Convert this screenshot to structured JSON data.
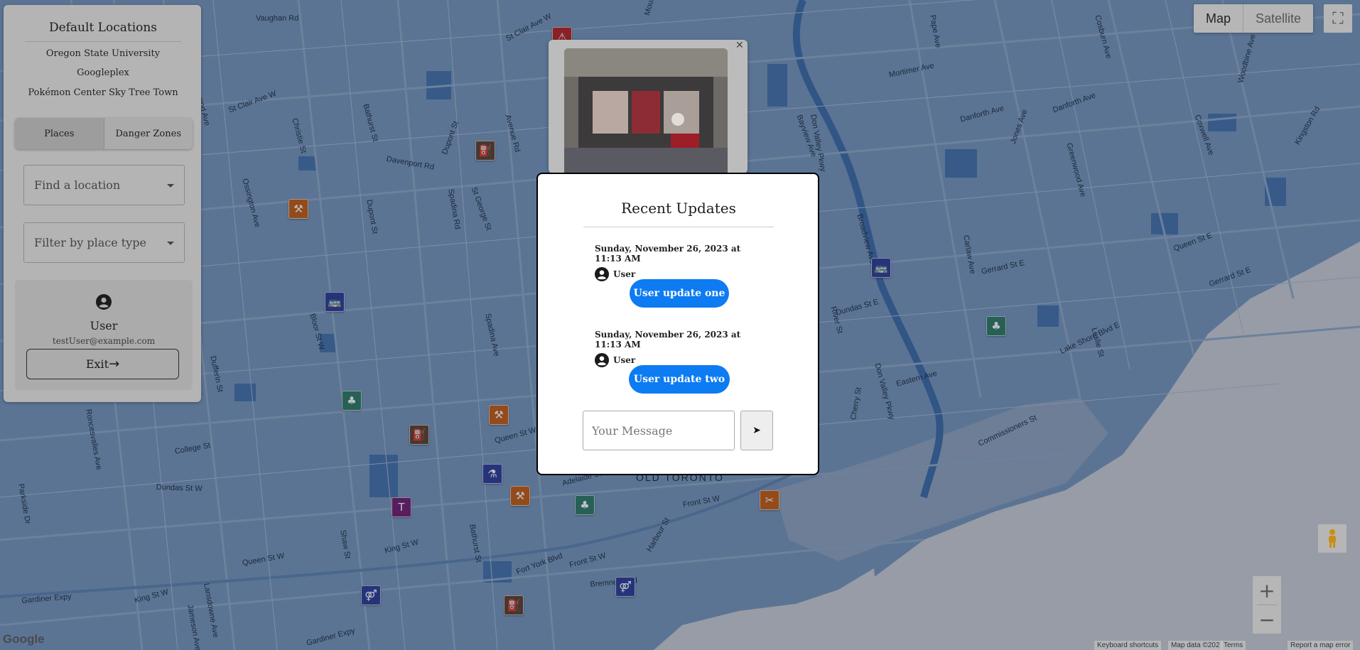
{
  "map": {
    "map_type_label": "Map",
    "satellite_label": "Satellite",
    "district_label": "OLD TORONTO",
    "google_logo": "Google",
    "attribution": {
      "shortcuts": "Keyboard shortcuts",
      "data": "Map data ©202",
      "terms": "Terms",
      "report": "Report a map error"
    },
    "street_labels": [
      "Vaughan Rd",
      "St Clair Ave W",
      "Mount Pleasant Rd",
      "Bayview Ave",
      "Pape Ave",
      "Oakwood Ave",
      "St Clair Ave W",
      "Christie St",
      "Bathurst St",
      "Avenue Rd",
      "Mortimer Ave",
      "Cosburn Ave",
      "Davenport Rd",
      "Dupont St",
      "Spadina Rd",
      "St George St",
      "Danforth Ave",
      "Danforth Ave",
      "Don Valley Pkwy",
      "Jones Ave",
      "Greenwood Ave",
      "Woodbine Ave",
      "Coxwell Ave",
      "Kingston Rd",
      "Ossington Ave",
      "Dupont St",
      "Gerrard St E",
      "Gerrard St E",
      "Queen St E",
      "Dundas St E",
      "Bloor St W",
      "Lake Shore Blvd E",
      "Dufferin St",
      "College St",
      "Dundas St W",
      "Queen St W",
      "King St W",
      "Gardiner Expy",
      "Adelaide St W",
      "Front St W",
      "Bremner Blvd",
      "Harbour St",
      "Commissioners St",
      "Eastern Ave",
      "Cherry St",
      "Roncesvalles Ave",
      "Parkside Dr",
      "Lansdowne Ave",
      "Shaw St",
      "Bathurst St",
      "Fort York Blvd",
      "Queen St W",
      "King St W",
      "Jameson Ave",
      "Spadina Ave",
      "Don Valley Pkwy",
      "Leslie St",
      "Carlaw Ave",
      "Broadview Ave",
      "River St",
      "Front St W",
      "Gardiner Expy"
    ],
    "markers": [
      {
        "kind": "tools",
        "color": "#c45f18",
        "icon": "wrench-icon"
      },
      {
        "kind": "gas",
        "color": "#5e4334",
        "icon": "gas-pump-icon"
      },
      {
        "kind": "transit",
        "color": "#2c3f9c",
        "icon": "bus-icon"
      },
      {
        "kind": "park",
        "color": "#2f7c6a",
        "icon": "tree-icon"
      },
      {
        "kind": "tools",
        "color": "#c45f18",
        "icon": "wrench-icon"
      },
      {
        "kind": "gas",
        "color": "#5e4334",
        "icon": "gas-pump-icon"
      },
      {
        "kind": "health",
        "color": "#2c3f9c",
        "icon": "bottle-icon"
      },
      {
        "kind": "clothing",
        "color": "#6f1f77",
        "icon": "shirt-icon"
      },
      {
        "kind": "tools",
        "color": "#c45f18",
        "icon": "wrench-icon"
      },
      {
        "kind": "park",
        "color": "#2f7c6a",
        "icon": "tree-icon"
      },
      {
        "kind": "transit",
        "color": "#2c3f9c",
        "icon": "bus-icon"
      },
      {
        "kind": "park",
        "color": "#2f7c6a",
        "icon": "tree-icon"
      },
      {
        "kind": "service",
        "color": "#c45f18",
        "icon": "hairdryer-icon"
      },
      {
        "kind": "restroom",
        "color": "#2c3f9c",
        "icon": "restroom-icon"
      },
      {
        "kind": "restroom",
        "color": "#2c3f9c",
        "icon": "restroom-icon"
      },
      {
        "kind": "gas",
        "color": "#5e4334",
        "icon": "gas-pump-icon"
      },
      {
        "kind": "alert",
        "color": "#b3262a",
        "icon": "alert-icon"
      }
    ]
  },
  "sidebar": {
    "title": "Default Locations",
    "locations": [
      "Oregon State University",
      "Googleplex",
      "Pokémon Center Sky Tree Town"
    ],
    "tabs": {
      "places": "Places",
      "danger": "Danger Zones"
    },
    "location_select_placeholder": "Find a location",
    "type_select_placeholder": "Filter by place type",
    "user": {
      "name": "User",
      "email": "testUser@example.com"
    },
    "exit_label": "Exit",
    "exit_arrow": "→"
  },
  "modal": {
    "title": "Recent Updates",
    "updates": [
      {
        "date": "Sunday, November 26, 2023 at 11:13 AM",
        "author": "User",
        "message": "User update one"
      },
      {
        "date": "Sunday, November 26, 2023 at 11:13 AM",
        "author": "User",
        "message": "User update two"
      }
    ],
    "input_placeholder": "Your Message",
    "send_icon": "➤"
  },
  "colors": {
    "accent": "#0d7bf2",
    "water": "#2f63a8",
    "land": "#6f8fb3"
  }
}
